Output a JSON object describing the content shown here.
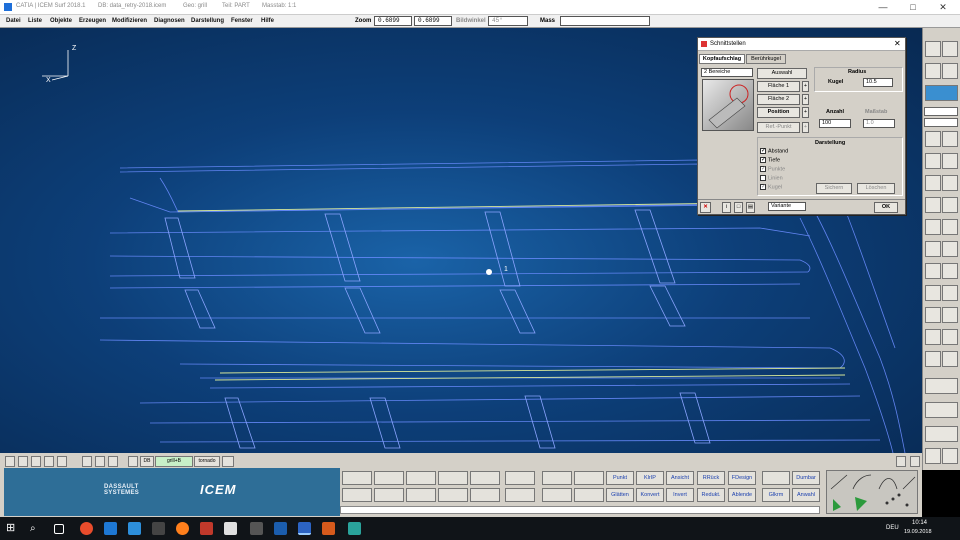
{
  "window": {
    "title_app": "CATIA | ICEM Surf 2018.1",
    "title_db": "DB: data_retry-2018.icem",
    "title_geo": "Geo: grill",
    "title_tool": "Teil: PART",
    "title_scale": "Masstab: 1:1",
    "minimize": "—",
    "maximize": "□",
    "close": "✕"
  },
  "menu": [
    "Datei",
    "Liste",
    "Objekte",
    "Erzeugen",
    "Modifizieren",
    "Diagnosen",
    "Darstellung",
    "Fenster",
    "Hilfe"
  ],
  "toolbar": {
    "zoom_label": "Zoom",
    "zoom_value1": "0.6899",
    "zoom_value2": "0.6899",
    "bild_label": "Bildwinkel",
    "bild_value": "45°",
    "mass_label": "Mass"
  },
  "viewport": {
    "axis_z": "Z",
    "axis_x": "X",
    "cursor_label": "1"
  },
  "dialog": {
    "title": "Schnittstellen",
    "close": "✕",
    "tabs": [
      "Kopfaufschlag",
      "Berührkugel"
    ],
    "mode_select": "2 Bereiche",
    "btn_auswahl": "Auswahl",
    "btn_flaeche1": "Fläche 1",
    "btn_flaeche2": "Fläche 2",
    "btn_position": "Position",
    "btn_refpunkt": "Ref.-Punkt",
    "radius_title": "Radius",
    "kugel_label": "Kugel",
    "kugel_value": "10.5",
    "anzahl_label": "Anzahl",
    "anzahl_value": "100",
    "massstab_label": "Maßstab",
    "massstab_value": "1.0",
    "darstellung_title": "Darstellung",
    "checks": [
      {
        "label": "Abstand",
        "checked": true,
        "enabled": true
      },
      {
        "label": "Tiefe",
        "checked": true,
        "enabled": true
      },
      {
        "label": "Punkte",
        "checked": true,
        "enabled": false
      },
      {
        "label": "Linien",
        "checked": false,
        "enabled": false
      },
      {
        "label": "Kugel",
        "checked": true,
        "enabled": false
      }
    ],
    "btn_sichern": "Sichern",
    "btn_loeschen": "Löschen",
    "variante_select": "Variante",
    "btn_ok": "OK"
  },
  "statusbar": {
    "db": "DB",
    "geo": "grill+B",
    "part": "tornado"
  },
  "bottom_buttons": {
    "row1": [
      "Punkt",
      "KlrIP",
      "Ansicht",
      "RRück",
      "FDesign",
      "Dumbar"
    ],
    "row2": [
      "Glätten",
      "Konvert",
      "Invert",
      "Redukt.",
      "Ablende",
      "Glkrm",
      "Anwahl"
    ]
  },
  "brand": {
    "ds_line1": "DASSAULT",
    "ds_line2": "SYSTEMES",
    "icem": "ICEM"
  },
  "taskbar": {
    "time": "10:14",
    "date": "19.09.2018",
    "lang": "DEU"
  },
  "colors": {
    "viewport_center": "#1a63a8",
    "wire": "#6a8cff",
    "highlight": "#d8e89a",
    "brand": "#2e6e97",
    "link_text": "#1a3fae"
  }
}
